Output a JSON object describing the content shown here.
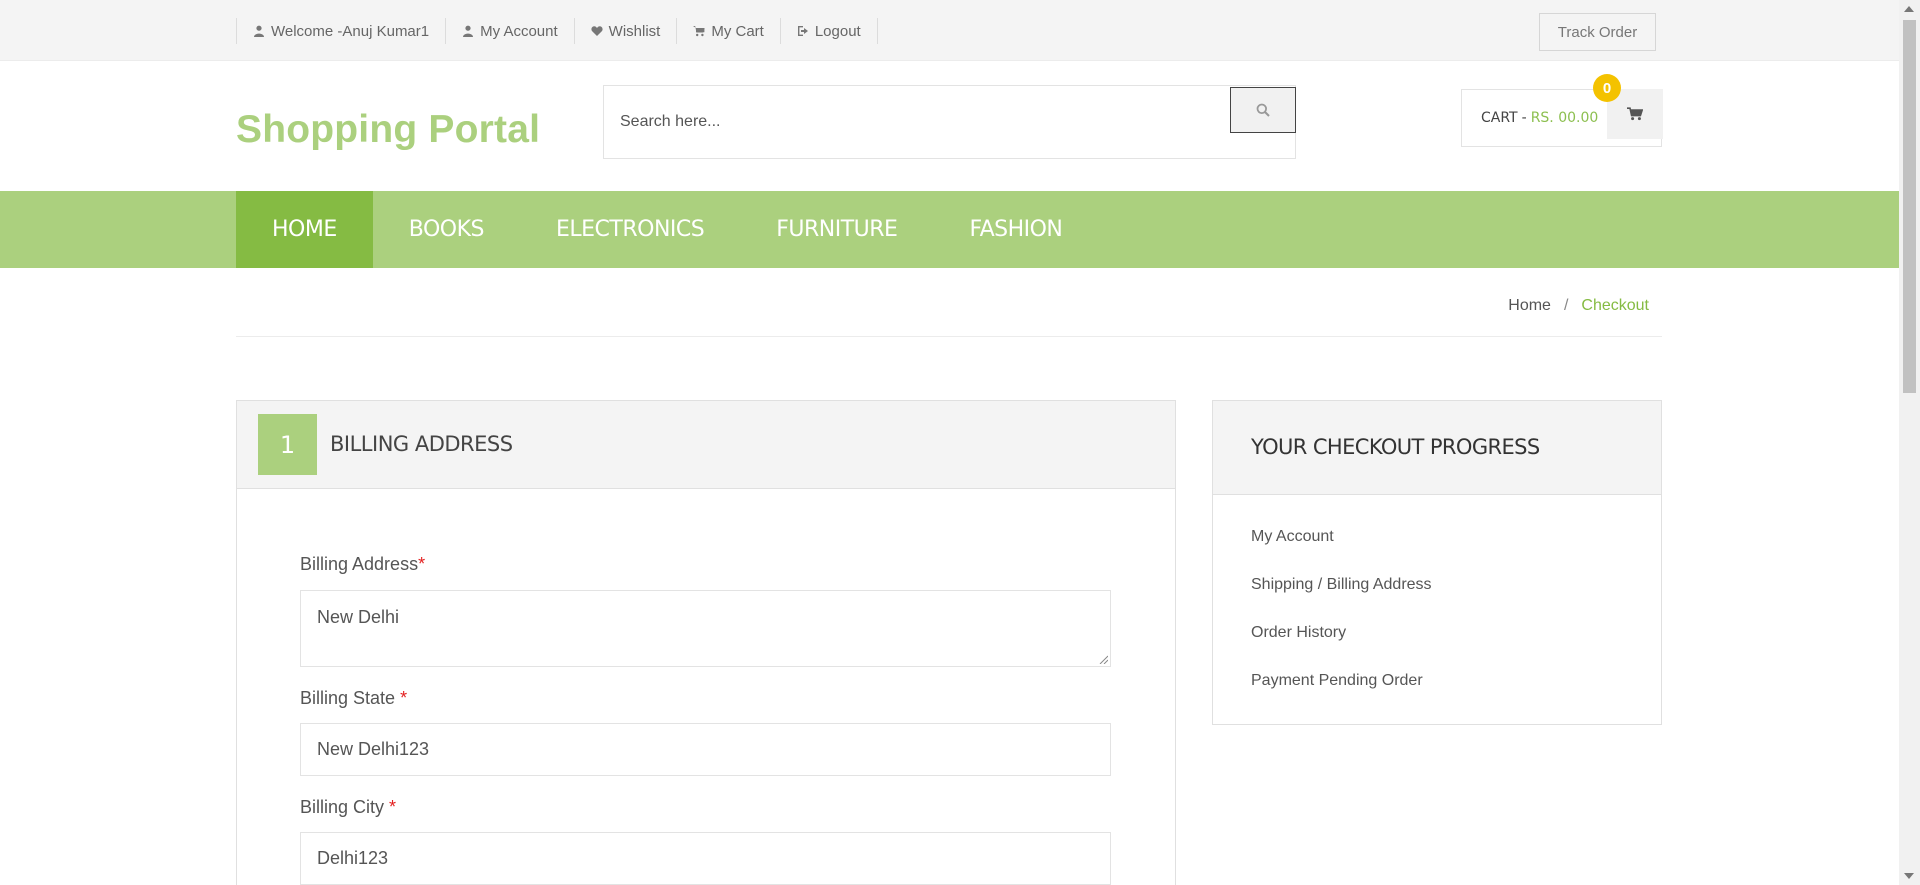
{
  "topbar": {
    "links": [
      {
        "label": "Welcome -Anuj Kumar1",
        "icon": "user-icon"
      },
      {
        "label": "My Account",
        "icon": "user-icon"
      },
      {
        "label": "Wishlist",
        "icon": "heart-icon"
      },
      {
        "label": "My Cart",
        "icon": "cart-icon"
      },
      {
        "label": "Logout",
        "icon": "logout-icon"
      }
    ],
    "track_order": "Track Order"
  },
  "header": {
    "logo": "Shopping Portal",
    "search_placeholder": "Search here...",
    "cart": {
      "label": "CART",
      "separator": "-",
      "price": "RS. 00.00",
      "count": "0"
    }
  },
  "nav": {
    "items": [
      "HOME",
      "BOOKS",
      "ELECTRONICS",
      "FURNITURE",
      "FASHION"
    ],
    "active": "HOME"
  },
  "breadcrumb": {
    "home": "Home",
    "separator": "/",
    "current": "Checkout"
  },
  "billing": {
    "step": "1",
    "title": "BILLING ADDRESS",
    "fields": {
      "address": {
        "label": "Billing Address",
        "required": "*",
        "value": "New Delhi"
      },
      "state": {
        "label": "Billing State ",
        "required": "*",
        "value": "New Delhi123"
      },
      "city": {
        "label": "Billing City ",
        "required": "*",
        "value": "Delhi123"
      }
    }
  },
  "progress": {
    "title": "YOUR CHECKOUT PROGRESS",
    "items": [
      "My Account",
      "Shipping / Billing Address",
      "Order History",
      "Payment Pending Order"
    ]
  },
  "colors": {
    "brand_green": "#abd07e",
    "active_green": "#85bb43",
    "badge_yellow": "#f4c200",
    "required_red": "#e32020"
  }
}
